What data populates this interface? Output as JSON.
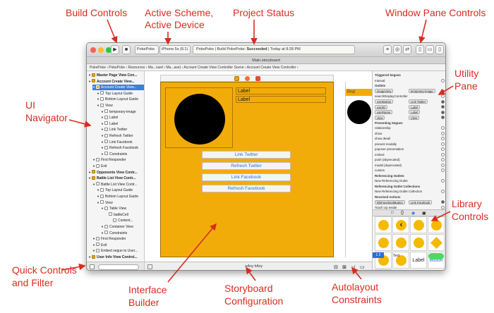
{
  "annotations": {
    "build_controls": "Build Controls",
    "active_scheme_line1": "Active Scheme,",
    "active_scheme_line2": "Active Device",
    "project_status": "Project Status",
    "window_pane_controls": "Window Pane Controls",
    "utility_pane_line1": "Utility",
    "utility_pane_line2": "Pane",
    "ui_navigator_line1": "UI",
    "ui_navigator_line2": "Navigator",
    "library_controls_line1": "Library",
    "library_controls_line2": "Controls",
    "quick_controls_line1": "Quick Controls",
    "quick_controls_line2": "and Filter",
    "interface_builder_line1": "Interface",
    "interface_builder_line2": "Builder",
    "storyboard_config_line1": "Storyboard",
    "storyboard_config_line2": "Configuration",
    "autolayout_line1": "Autolayout",
    "autolayout_line2": "Constraints"
  },
  "colors": {
    "annotation": "#d92b20",
    "scene_bg": "#f2ac0a",
    "selection": "#3d7ed8",
    "button_text": "#2a6fd6"
  },
  "toolbar": {
    "scheme": "PokePoke",
    "device": "iPhone 5s (8.1)",
    "status_prefix": "PokePoke  |  Build PokePoke: ",
    "status_result": "Succeeded",
    "status_time": "  |  Today at 8:28 PM"
  },
  "tab": {
    "title": "Main.storyboard"
  },
  "jumpbar": {
    "text": "PokePoke  ›  PokePoke  ›  Resources  ›  Ma...oard  ›  Ma...ase)  ›  Account Create View Controller Scene  ›  Account Create View Controller  ›"
  },
  "navigator": {
    "rows": [
      {
        "text": "Master Page View Con...",
        "level": 0,
        "header": true
      },
      {
        "text": "Account Create View...",
        "level": 0,
        "header": true
      },
      {
        "text": "Account Create View...",
        "level": 1,
        "selected": true
      },
      {
        "text": "Top Layout Guide",
        "level": 2
      },
      {
        "text": "Bottom Layout Guide",
        "level": 2
      },
      {
        "text": "View",
        "level": 2
      },
      {
        "text": "temporary-image",
        "level": 3
      },
      {
        "text": "Label",
        "level": 3
      },
      {
        "text": "Label",
        "level": 3
      },
      {
        "text": "Link Twitter",
        "level": 3
      },
      {
        "text": "Refresh Twitter",
        "level": 3
      },
      {
        "text": "Link Facebook",
        "level": 3
      },
      {
        "text": "Refresh Facebook",
        "level": 3
      },
      {
        "text": "Constraints",
        "level": 3
      },
      {
        "text": "First Responder",
        "level": 1
      },
      {
        "text": "Exit",
        "level": 1
      },
      {
        "text": "Opponents View Contr...",
        "level": 0,
        "header": true
      },
      {
        "text": "Battle List View Contr...",
        "level": 0,
        "header": true
      },
      {
        "text": "Battle List View Contr...",
        "level": 1
      },
      {
        "text": "Top Layout Guide",
        "level": 2
      },
      {
        "text": "Bottom Layout Guide",
        "level": 2
      },
      {
        "text": "View",
        "level": 2
      },
      {
        "text": "Table View",
        "level": 3
      },
      {
        "text": "battleCell",
        "level": 4
      },
      {
        "text": "Content...",
        "level": 5
      },
      {
        "text": "Container View",
        "level": 3
      },
      {
        "text": "Constraints",
        "level": 3
      },
      {
        "text": "First Responder",
        "level": 1
      },
      {
        "text": "Exit",
        "level": 1
      },
      {
        "text": "Embed segue to User...",
        "level": 1
      },
      {
        "text": "User Info View Control...",
        "level": 0,
        "header": true
      }
    ]
  },
  "scene": {
    "label1": "Label",
    "label2": "Label",
    "buttons": [
      "Link Twitter",
      "Refresh Twitter",
      "Link Facebook",
      "Refresh Facebook"
    ],
    "proto_label": "Prot"
  },
  "canvas_bottom": {
    "size_class": "wAny hAny"
  },
  "utility": {
    "rows": [
      {
        "text": "Triggered Segues",
        "section": true
      },
      {
        "text": "manual"
      },
      {
        "text": "Outlets",
        "section": true
      },
      {
        "chip": "imageView",
        "link": "temporary-image",
        "dot": true
      },
      {
        "text": "searchDisplayController"
      },
      {
        "chip": "userButton",
        "link": "Link Twitter",
        "dot": true
      },
      {
        "chip": "userID",
        "link": "Label",
        "dot": true
      },
      {
        "chip": "userName",
        "link": "Label",
        "dot": true
      },
      {
        "chip": "view",
        "link": "View",
        "dot": true
      },
      {
        "text": "Presenting Segues",
        "section": true
      },
      {
        "text": "relationship"
      },
      {
        "text": "show"
      },
      {
        "text": "show detail"
      },
      {
        "text": "present modally"
      },
      {
        "text": "popover presentation"
      },
      {
        "text": "embed"
      },
      {
        "text": "push (deprecated)"
      },
      {
        "text": "modal (deprecated)"
      },
      {
        "text": "custom"
      },
      {
        "text": "Referencing Outlets",
        "section": true
      },
      {
        "text": "New Referencing Outlet"
      },
      {
        "text": "Referencing Outlet Collections",
        "section": true
      },
      {
        "text": "New Referencing Outlet Collection"
      },
      {
        "text": "Received Actions",
        "section": true
      },
      {
        "chip": "linkFacebookButton",
        "link": "Link Facebook",
        "dot": true
      },
      {
        "text": "                                       Touch Up Inside"
      }
    ],
    "library_label": "Label",
    "library_button": "Button",
    "library_text": "Text"
  }
}
